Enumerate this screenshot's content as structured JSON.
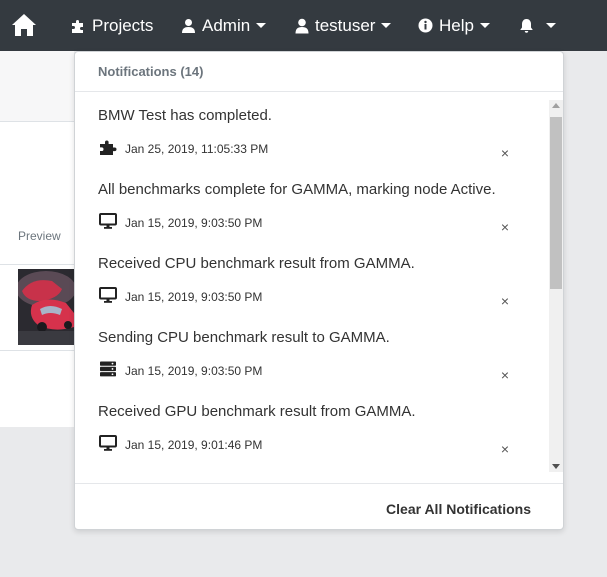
{
  "navbar": {
    "home_icon": "home-icon",
    "projects_label": "Projects",
    "admin_label": "Admin",
    "user_label": "testuser",
    "help_label": "Help",
    "bell_icon": "bell-icon",
    "background_color": "#343a40"
  },
  "background": {
    "preview_label": "Preview"
  },
  "notifications": {
    "header": "Notifications (14)",
    "items": [
      {
        "message": "BMW Test has completed.",
        "icon": "puzzle-icon",
        "time": "Jan 25, 2019, 11:05:33 PM",
        "close": "×"
      },
      {
        "message": "All benchmarks complete for GAMMA, marking node Active.",
        "icon": "desktop-icon",
        "time": "Jan 15, 2019, 9:03:50 PM",
        "close": "×"
      },
      {
        "message": "Received CPU benchmark result from GAMMA.",
        "icon": "desktop-icon",
        "time": "Jan 15, 2019, 9:03:50 PM",
        "close": "×"
      },
      {
        "message": "Sending CPU benchmark result to GAMMA.",
        "icon": "server-icon",
        "time": "Jan 15, 2019, 9:03:50 PM",
        "close": "×"
      },
      {
        "message": "Received GPU benchmark result from GAMMA.",
        "icon": "desktop-icon",
        "time": "Jan 15, 2019, 9:01:46 PM",
        "close": "×"
      }
    ],
    "clear_all_label": "Clear All Notifications"
  }
}
